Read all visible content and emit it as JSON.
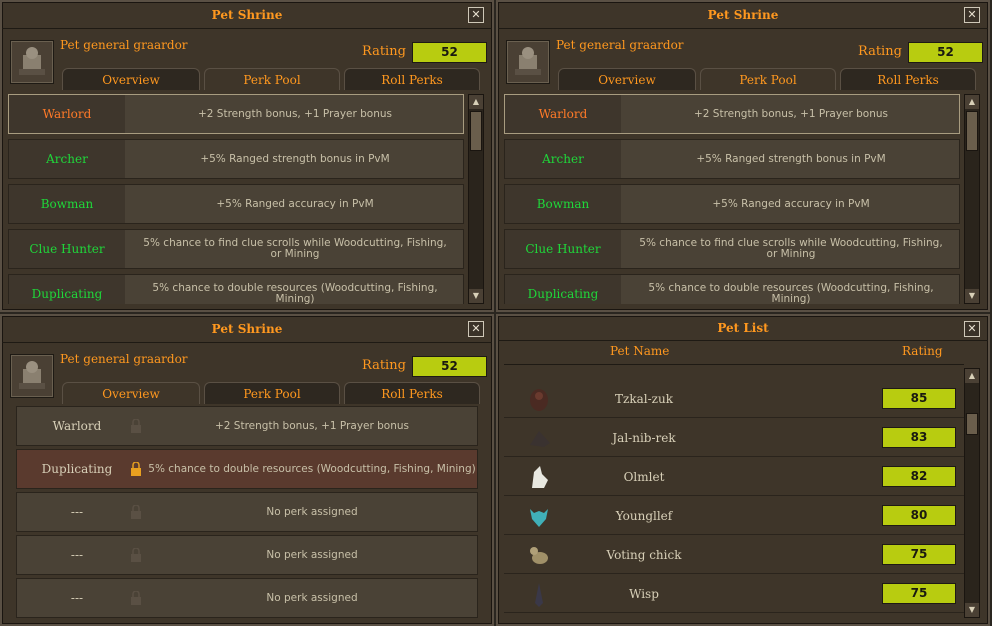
{
  "shrine_panels": [
    {
      "title": "Pet Shrine",
      "pet_name": "Pet general graardor",
      "rating_label": "Rating",
      "rating": "52",
      "tabs": [
        "Overview",
        "Perk Pool",
        "Roll Perks"
      ],
      "active_tab": "Perk Pool",
      "perks": [
        {
          "name": "Warlord",
          "desc": "+2 Strength bonus, +1 Prayer bonus",
          "color": "#ff7a28"
        },
        {
          "name": "Archer",
          "desc": "+5% Ranged strength bonus in PvM",
          "color": "#1fd83a"
        },
        {
          "name": "Bowman",
          "desc": "+5% Ranged accuracy in PvM",
          "color": "#1fd83a"
        },
        {
          "name": "Clue Hunter",
          "desc": "5% chance to find clue scrolls while Woodcutting, Fishing, or Mining",
          "color": "#1fd83a"
        },
        {
          "name": "Duplicating",
          "desc": "5% chance to double resources (Woodcutting, Fishing, Mining)",
          "color": "#1fd83a"
        }
      ]
    },
    {
      "title": "Pet Shrine",
      "pet_name": "Pet general graardor",
      "rating_label": "Rating",
      "rating": "52",
      "tabs": [
        "Overview",
        "Perk Pool",
        "Roll Perks"
      ],
      "active_tab": "Perk Pool",
      "perks": [
        {
          "name": "Warlord",
          "desc": "+2 Strength bonus, +1 Prayer bonus",
          "color": "#ff7a28"
        },
        {
          "name": "Archer",
          "desc": "+5% Ranged strength bonus in PvM",
          "color": "#1fd83a"
        },
        {
          "name": "Bowman",
          "desc": "+5% Ranged accuracy in PvM",
          "color": "#1fd83a"
        },
        {
          "name": "Clue Hunter",
          "desc": "5% chance to find clue scrolls while Woodcutting, Fishing, or Mining",
          "color": "#1fd83a"
        },
        {
          "name": "Duplicating",
          "desc": "5% chance to double resources (Woodcutting, Fishing, Mining)",
          "color": "#1fd83a"
        }
      ]
    }
  ],
  "overview_panel": {
    "title": "Pet Shrine",
    "pet_name": "Pet general graardor",
    "rating_label": "Rating",
    "rating": "52",
    "tabs": [
      "Overview",
      "Perk Pool",
      "Roll Perks"
    ],
    "active_tab": "Overview",
    "slots": [
      {
        "name": "Warlord",
        "desc": "+2 Strength bonus, +1 Prayer bonus",
        "locked": false
      },
      {
        "name": "Duplicating",
        "desc": "5% chance to double resources (Woodcutting, Fishing, Mining)",
        "locked": true
      },
      {
        "name": "---",
        "desc": "No perk assigned",
        "locked": false
      },
      {
        "name": "---",
        "desc": "No perk assigned",
        "locked": false
      },
      {
        "name": "---",
        "desc": "No perk assigned",
        "locked": false
      }
    ]
  },
  "pet_list": {
    "title": "Pet List",
    "col_name": "Pet Name",
    "col_rating": "Rating",
    "pets": [
      {
        "name": "Tzkal-zuk",
        "rating": "85",
        "icon": "tzkal-zuk-icon"
      },
      {
        "name": "Jal-nib-rek",
        "rating": "83",
        "icon": "jal-nib-rek-icon"
      },
      {
        "name": "Olmlet",
        "rating": "82",
        "icon": "olmlet-icon"
      },
      {
        "name": "Youngllef",
        "rating": "80",
        "icon": "youngllef-icon"
      },
      {
        "name": "Voting chick",
        "rating": "75",
        "icon": "voting-chick-icon"
      },
      {
        "name": "Wisp",
        "rating": "75",
        "icon": "wisp-icon"
      }
    ]
  },
  "icons": {
    "close": "close-icon",
    "pet": "graardor-pet-icon",
    "lock": "padlock-icon"
  }
}
